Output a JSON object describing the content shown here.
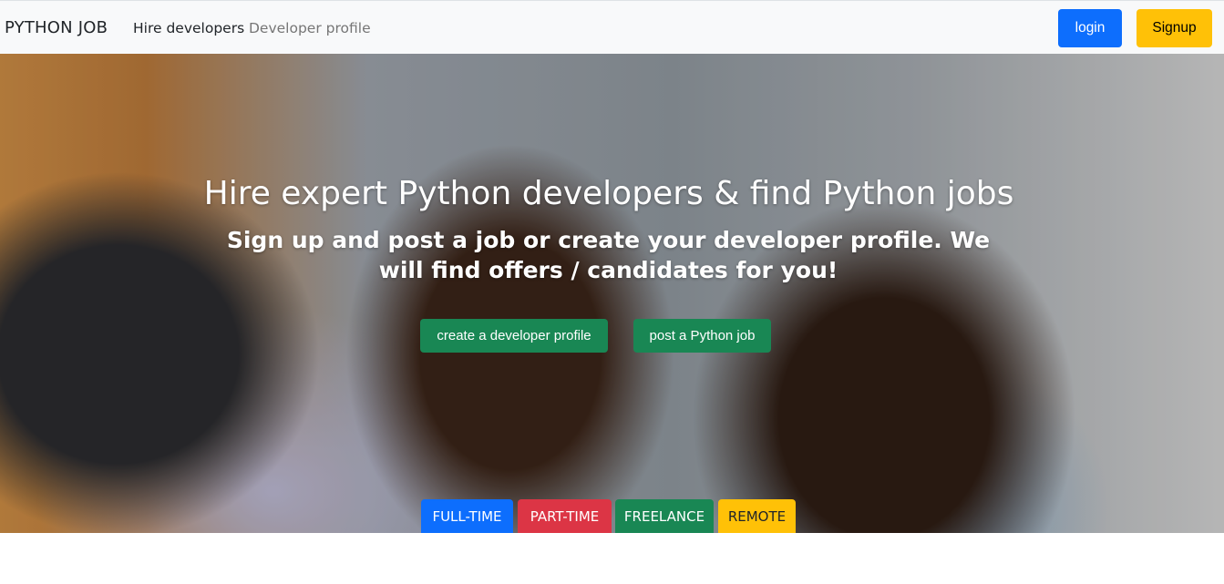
{
  "navbar": {
    "brand": "PYTHON JOB",
    "links": [
      {
        "label": "Hire developers"
      },
      {
        "label": "Developer profile"
      }
    ],
    "login_label": "login",
    "signup_label": "Signup"
  },
  "hero": {
    "title": "Hire expert Python developers & find Python jobs",
    "subtitle": "Sign up and post a job or create your developer profile. We will find offers / candidates for you!",
    "buttons": {
      "create_profile": "create a developer profile",
      "post_job": "post a Python job"
    },
    "job_types": [
      {
        "label": "FULL-TIME",
        "color": "#0d6efd"
      },
      {
        "label": "PART-TIME",
        "color": "#dc3545"
      },
      {
        "label": "FREELANCE",
        "color": "#198754"
      },
      {
        "label": "REMOTE",
        "color": "#ffc107"
      }
    ]
  },
  "colors": {
    "primary": "#0d6efd",
    "warning": "#ffc107",
    "success": "#198754",
    "danger": "#dc3545",
    "navbar_bg": "#f8f9fa"
  }
}
